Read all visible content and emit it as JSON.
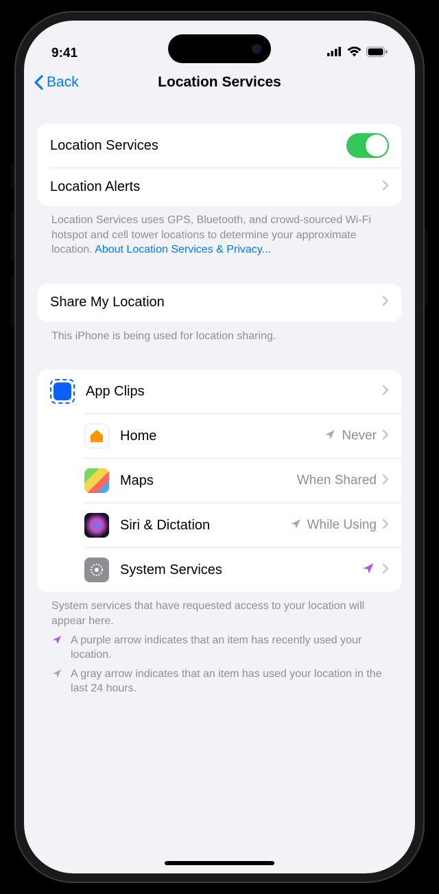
{
  "status": {
    "time": "9:41"
  },
  "nav": {
    "back": "Back",
    "title": "Location Services"
  },
  "group1": {
    "location_services": "Location Services",
    "location_alerts": "Location Alerts"
  },
  "footer1": {
    "text": "Location Services uses GPS, Bluetooth, and crowd-sourced Wi-Fi hotspot and cell tower locations to determine your approximate location. ",
    "link": "About Location Services & Privacy..."
  },
  "group2": {
    "share": "Share My Location"
  },
  "footer2": "This iPhone is being used for location sharing.",
  "apps": [
    {
      "label": "App Clips",
      "status": "",
      "arrow": ""
    },
    {
      "label": "Home",
      "status": "Never",
      "arrow": "gray"
    },
    {
      "label": "Maps",
      "status": "When Shared",
      "arrow": ""
    },
    {
      "label": "Siri & Dictation",
      "status": "While Using",
      "arrow": "gray"
    },
    {
      "label": "System Services",
      "status": "",
      "arrow": "purple"
    }
  ],
  "footer3": "System services that have requested access to your location will appear here.",
  "legend": {
    "purple": "A purple arrow indicates that an item has recently used your location.",
    "gray": "A gray arrow indicates that an item has used your location in the last 24 hours."
  }
}
